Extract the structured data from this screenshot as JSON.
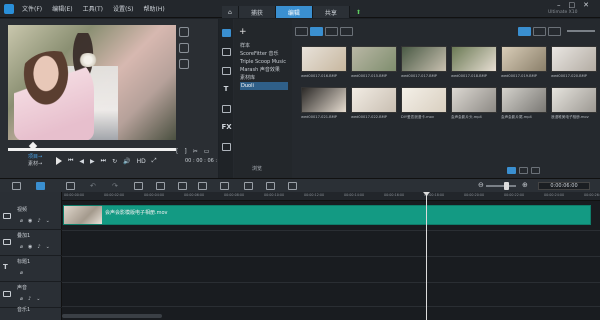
{
  "menus": [
    "文件(F)",
    "编辑(E)",
    "工具(T)",
    "设置(S)",
    "帮助(H)"
  ],
  "tabs": [
    "捕获",
    "编辑",
    "共享"
  ],
  "version": "Ultimate X10",
  "preview": {
    "mode_project": "项目→",
    "mode_clip": "素材→",
    "hd": "HD",
    "timecode": "00 : 00 : 06 : 00",
    "markers": [
      "[",
      "]"
    ]
  },
  "library": {
    "add": "+",
    "folders": [
      "样本",
      "ScoreFitter 音乐",
      "Triple Scoop Music",
      "Marash 声音效果",
      "素材库",
      "Duoli"
    ],
    "browse_label": "浏览",
    "thumbnails": [
      {
        "label": "wed00017-016.BMP",
        "colors": [
          "#e8e2da",
          "#c7b79f"
        ]
      },
      {
        "label": "wed00017-015.BMP",
        "colors": [
          "#b9b7a5",
          "#7f8e6e"
        ]
      },
      {
        "label": "wed00017-017.BMP",
        "colors": [
          "#4a5a45",
          "#c8c0b0"
        ]
      },
      {
        "label": "wed00017-018.BMP",
        "colors": [
          "#6b7a55",
          "#e7ded3"
        ]
      },
      {
        "label": "wed00017-019.BMP",
        "colors": [
          "#d9cdb8",
          "#8a7f6a"
        ]
      },
      {
        "label": "wed00017-020.BMP",
        "colors": [
          "#e9e6e2",
          "#b3aca3"
        ]
      },
      {
        "label": "wed00017-021.BMP",
        "colors": [
          "#2c2a28",
          "#e6dcd0"
        ]
      },
      {
        "label": "wed00017-022.BMP",
        "colors": [
          "#f2ece4",
          "#c9bfb2"
        ]
      },
      {
        "label": "DIY爱恋浪漫卡.mov",
        "colors": [
          "#f4f0e8",
          "#d9cfc0"
        ]
      },
      {
        "label": "会声会影片头.mp4",
        "colors": [
          "#dcd8d2",
          "#8d8a85"
        ]
      },
      {
        "label": "会声会影片尾.mp4",
        "colors": [
          "#d4d2cc",
          "#7a7874"
        ]
      },
      {
        "label": "浪漫唯美电子相册.mov",
        "colors": [
          "#e6e4de",
          "#9c9892"
        ]
      }
    ]
  },
  "timeline": {
    "timecode": "0:00:06:00",
    "tracks": [
      "视频",
      "叠加1",
      "标题1",
      "声音",
      "音乐1"
    ],
    "ruler": [
      "00:00:00:00",
      "00:00:02:00",
      "00:00:04:00",
      "00:00:06:00",
      "00:00:08:00",
      "00:00:10:00",
      "00:00:12:00",
      "00:00:14:00",
      "00:00:16:00",
      "00:00:18:00",
      "00:00:20:00",
      "00:00:22:00",
      "00:00:24:00",
      "00:00:26:00"
    ],
    "clip_label": "会声会影模版电子相册.mov"
  },
  "colors": {
    "accent": "#3a8fd0",
    "clip": "#139a83"
  }
}
